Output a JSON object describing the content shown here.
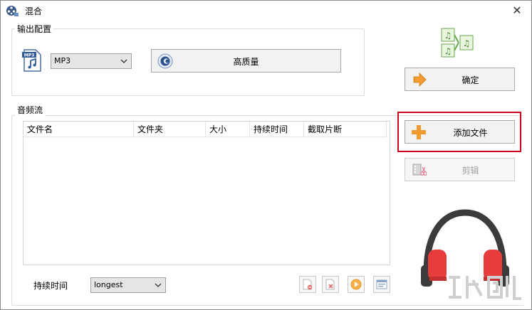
{
  "window": {
    "title": "混合",
    "close_glyph": "✕"
  },
  "output_config": {
    "label": "输出配置",
    "format_value": "MP3",
    "quality_button": "高质量"
  },
  "confirm_button": "确定",
  "audio_stream": {
    "label": "音频流",
    "columns": [
      "文件名",
      "文件夹",
      "大小",
      "持续时间",
      "截取片断"
    ]
  },
  "add_file_button": "添加文件",
  "cut_button": "剪辑",
  "duration": {
    "label": "持续时间",
    "value": "longest"
  }
}
